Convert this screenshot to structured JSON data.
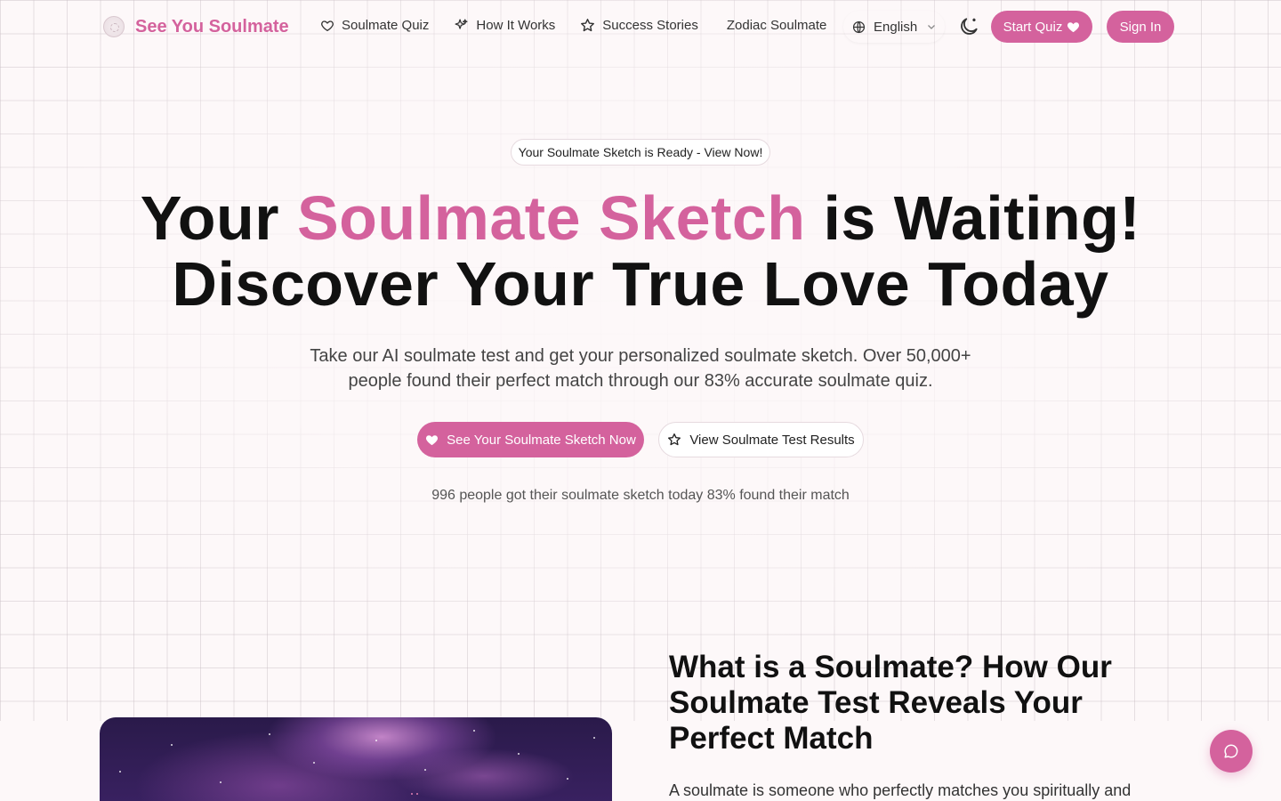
{
  "brand": {
    "name": "See You Soulmate",
    "accent": "#d4629d"
  },
  "nav": {
    "items": [
      {
        "label": "Soulmate Quiz",
        "icon": "heart-outline-icon"
      },
      {
        "label": "How It Works",
        "icon": "sparkles-icon"
      },
      {
        "label": "Success Stories",
        "icon": "star-outline-icon"
      },
      {
        "label": "Zodiac Soulmate",
        "icon": ""
      }
    ],
    "language": "English",
    "theme_toggle_icon": "moon-icon",
    "start_quiz_label": "Start Quiz",
    "sign_in_label": "Sign In"
  },
  "hero": {
    "badge": "Your Soulmate Sketch is Ready - View Now!",
    "title_part1": "Your ",
    "title_highlight": "Soulmate Sketch",
    "title_part2": " is Waiting!",
    "title_line2": "Discover Your True Love Today",
    "subtitle_line1": "Take our AI soulmate test and get your personalized soulmate sketch. Over 50,000+",
    "subtitle_line2": "people found their perfect match through our 83% accurate soulmate quiz.",
    "cta_primary": "See Your Soulmate Sketch Now",
    "cta_secondary": "View Soulmate Test Results",
    "stats": "996 people got their soulmate sketch today 83% found their match"
  },
  "section": {
    "title": "What is a Soulmate? How Our Soulmate Test Reveals Your Perfect Match",
    "body": "A soulmate is someone who perfectly matches you spiritually and"
  },
  "chat": {
    "icon": "chat-bubble-icon"
  }
}
